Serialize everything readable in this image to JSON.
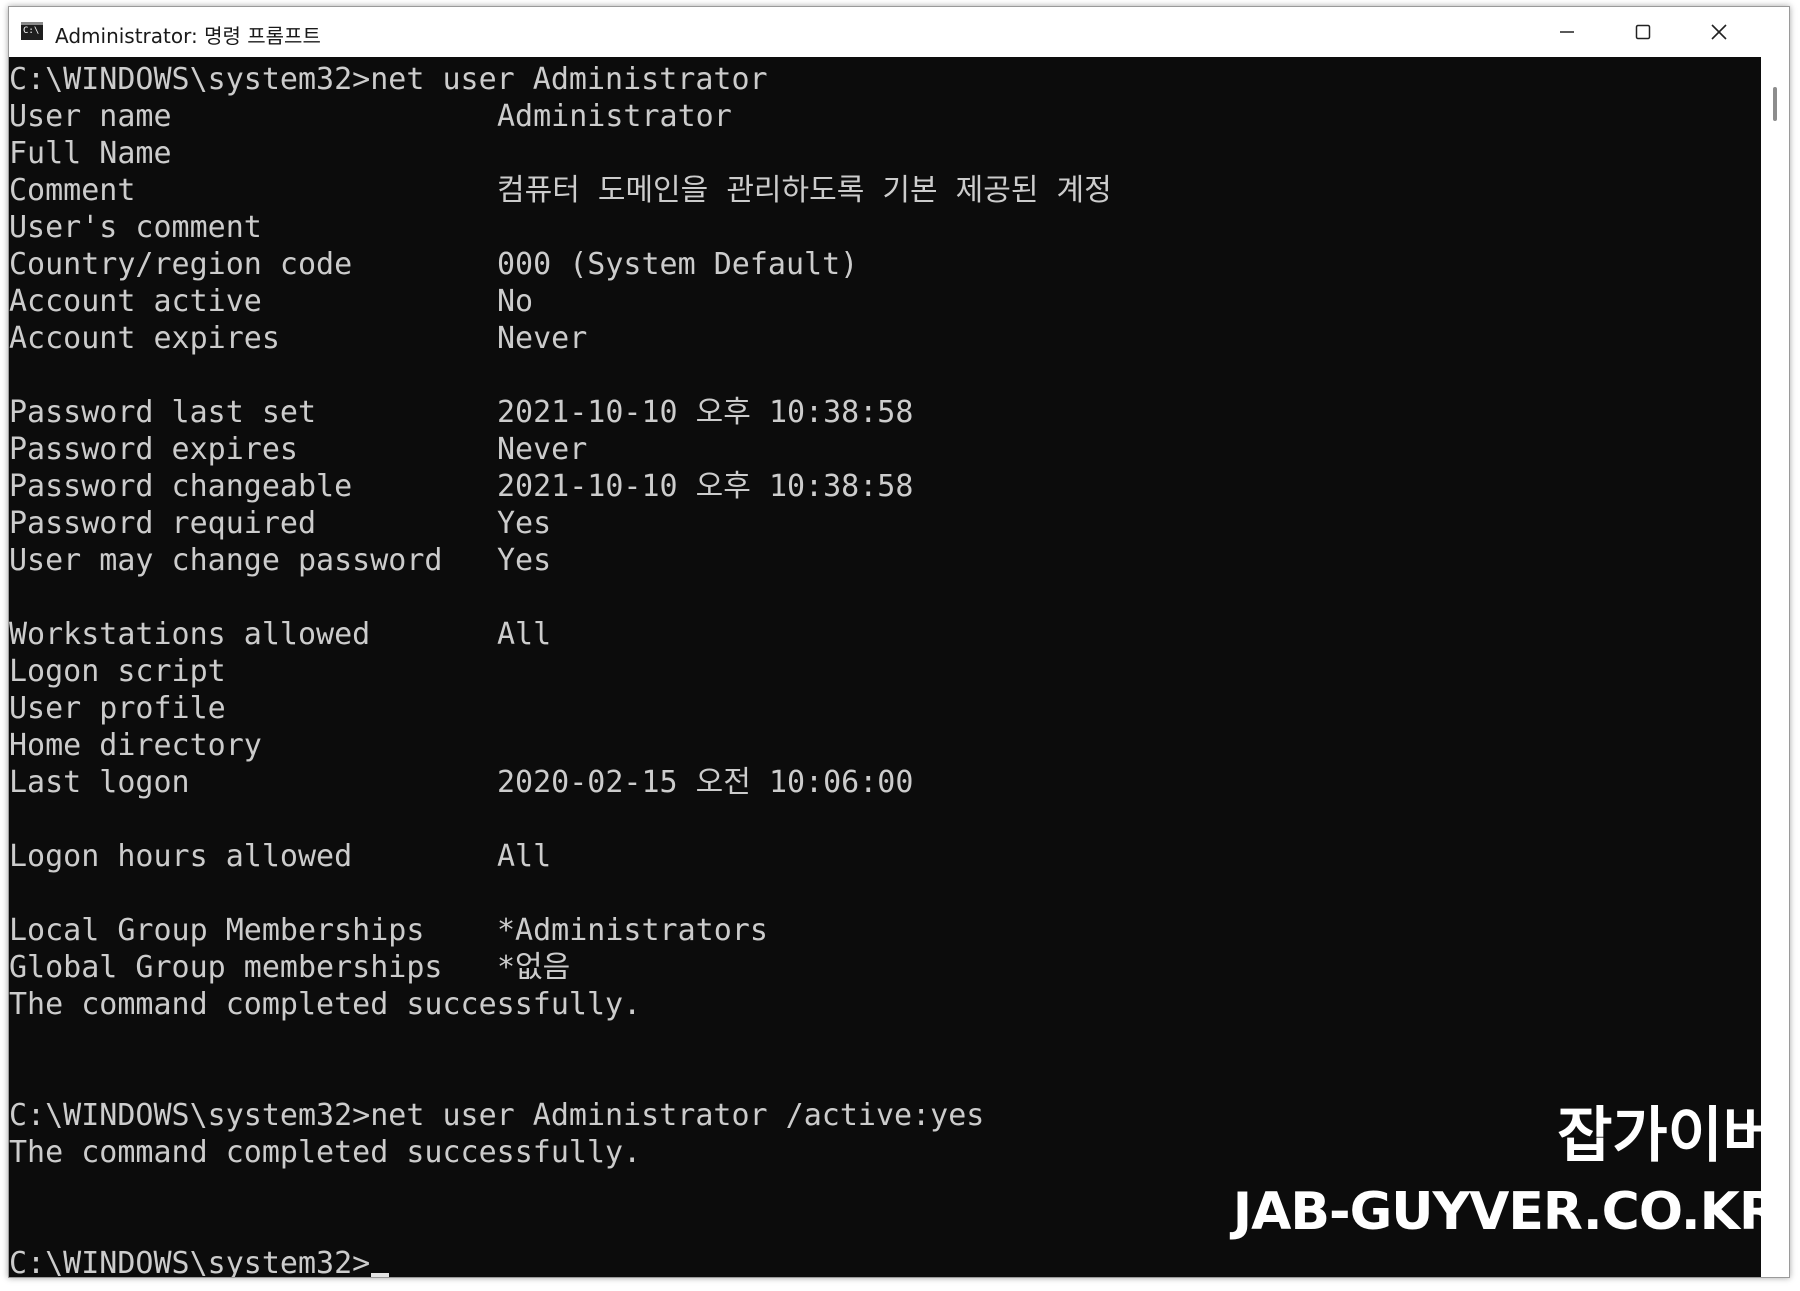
{
  "window": {
    "title": "Administrator: 명령 프롬프트",
    "app_icon_text": "C:\\"
  },
  "console": {
    "lines": [
      {
        "text": "C:\\WINDOWS\\system32>net user Administrator"
      },
      {
        "key": "User name",
        "value": "Administrator"
      },
      {
        "key": "Full Name",
        "value": ""
      },
      {
        "key": "Comment",
        "value": "컴퓨터 도메인을 관리하도록 기본 제공된 계정"
      },
      {
        "key": "User's comment",
        "value": ""
      },
      {
        "key": "Country/region code",
        "value": "000 (System Default)"
      },
      {
        "key": "Account active",
        "value": "No"
      },
      {
        "key": "Account expires",
        "value": "Never"
      },
      {
        "text": ""
      },
      {
        "key": "Password last set",
        "value": "2021-10-10 오후 10:38:58"
      },
      {
        "key": "Password expires",
        "value": "Never"
      },
      {
        "key": "Password changeable",
        "value": "2021-10-10 오후 10:38:58"
      },
      {
        "key": "Password required",
        "value": "Yes"
      },
      {
        "key": "User may change password",
        "value": "Yes"
      },
      {
        "text": ""
      },
      {
        "key": "Workstations allowed",
        "value": "All"
      },
      {
        "key": "Logon script",
        "value": ""
      },
      {
        "key": "User profile",
        "value": ""
      },
      {
        "key": "Home directory",
        "value": ""
      },
      {
        "key": "Last logon",
        "value": "2020-02-15 오전 10:06:00"
      },
      {
        "text": ""
      },
      {
        "key": "Logon hours allowed",
        "value": "All"
      },
      {
        "text": ""
      },
      {
        "key": "Local Group Memberships",
        "value": "*Administrators"
      },
      {
        "key": "Global Group memberships",
        "value": "*없음"
      },
      {
        "text": "The command completed successfully."
      },
      {
        "text": ""
      },
      {
        "text": ""
      },
      {
        "text": "C:\\WINDOWS\\system32>net user Administrator /active:yes"
      },
      {
        "text": "The command completed successfully."
      },
      {
        "text": ""
      },
      {
        "text": ""
      },
      {
        "text": "C:\\WINDOWS\\system32>",
        "cursor": true
      }
    ]
  },
  "watermark": {
    "korean": "잡가이버",
    "site": "JAB-GUYVER.CO.KR"
  },
  "colors": {
    "console_bg": "#0c0c0c",
    "console_text": "#cccccc",
    "titlebar_bg": "#ffffff"
  }
}
